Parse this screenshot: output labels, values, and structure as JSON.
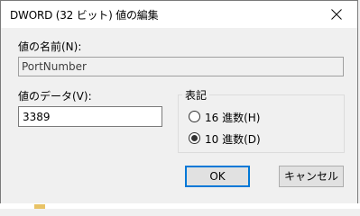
{
  "window": {
    "title": "DWORD (32 ビット) 値の編集"
  },
  "value_name": {
    "label": "値の名前(N):",
    "value": "PortNumber"
  },
  "value_data": {
    "label": "値のデータ(V):",
    "value": "3389"
  },
  "base": {
    "label": "表記",
    "options": [
      {
        "label": "16 進数(H)",
        "selected": false
      },
      {
        "label": "10 進数(D)",
        "selected": true
      }
    ]
  },
  "buttons": {
    "ok": "OK",
    "cancel": "キャンセル"
  },
  "colors": {
    "focus_border": "#0078d7",
    "window_bg": "#f0f0f0"
  },
  "icons": {
    "close": "close-icon"
  }
}
